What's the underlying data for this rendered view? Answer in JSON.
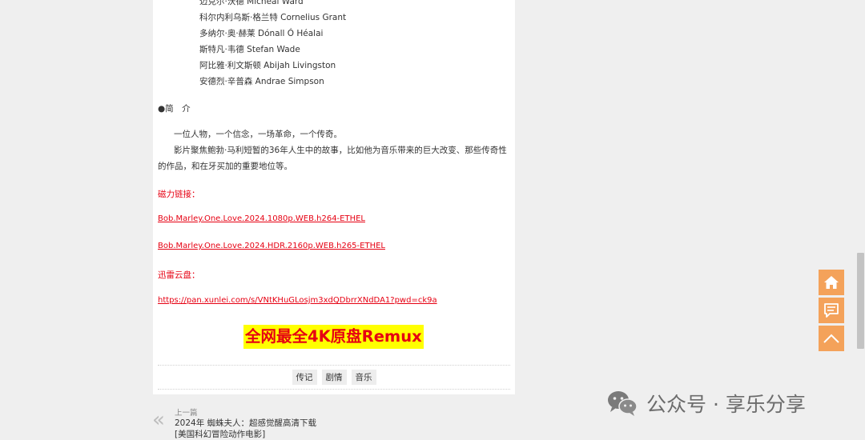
{
  "cast": [
    "迈克尔·沃德 Micheal Ward",
    "科尔内利乌斯·格兰特 Cornelius Grant",
    "多纳尔·奥·赫莱 Dónall Ó Héalai",
    "斯特凡·韦德 Stefan Wade",
    "阿比雅·利文斯顿 Abijah Livingston",
    "安德烈·辛普森 Andrae Simpson"
  ],
  "intro": {
    "heading": "●简　介",
    "line1": "一位人物，一个信念，一场革命，一个传奇。",
    "line2": "影片聚焦鲍勃·马利短暂的36年人生中的故事，比如他为音乐带来的巨大改变、那些传奇性的作品，和在牙买加的重要地位等。"
  },
  "magnet": {
    "label": "磁力链接：",
    "links": [
      "Bob.Marley.One.Love.2024.1080p.WEB.h264-ETHEL",
      "Bob.Marley.One.Love.2024.HDR.2160p.WEB.h265-ETHEL"
    ]
  },
  "xunlei": {
    "label": "迅雷云盘：",
    "link": "https://pan.xunlei.com/s/VNtKHuGLosjm3xdQDbrrXNdDA1?pwd=ck9a"
  },
  "banner": "全网最全4K原盘Remux",
  "tags": [
    "传记",
    "剧情",
    "音乐"
  ],
  "prev": {
    "label": "上一篇",
    "title": "2024年 蜘蛛夫人：超感觉醒高清下载",
    "subtitle": "[美国科幻冒险动作电影]"
  },
  "side_buttons": {
    "home": "home-icon",
    "comment": "comment-icon",
    "top": "chevron-up-icon"
  },
  "watermark": "公众号 · 享乐分享",
  "colors": {
    "accent_red": "#e60012",
    "banner_yellow": "#ffff00",
    "side_orange": "#f4a25a"
  }
}
